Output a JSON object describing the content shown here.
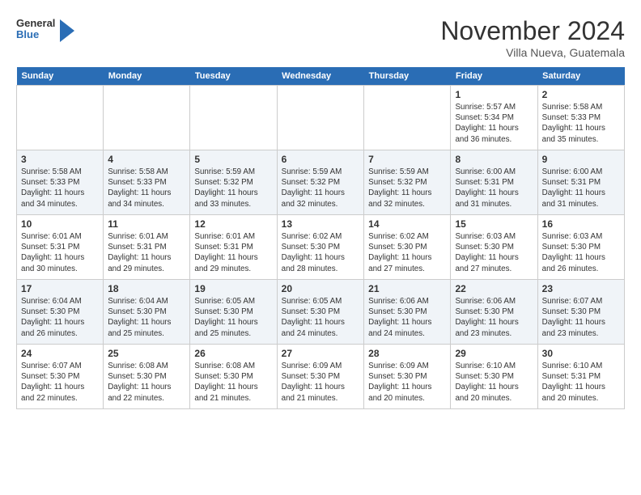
{
  "header": {
    "logo": {
      "line1": "General",
      "line2": "Blue"
    },
    "title": "November 2024",
    "location": "Villa Nueva, Guatemala"
  },
  "calendar": {
    "days_of_week": [
      "Sunday",
      "Monday",
      "Tuesday",
      "Wednesday",
      "Thursday",
      "Friday",
      "Saturday"
    ],
    "weeks": [
      [
        {
          "day": "",
          "info": ""
        },
        {
          "day": "",
          "info": ""
        },
        {
          "day": "",
          "info": ""
        },
        {
          "day": "",
          "info": ""
        },
        {
          "day": "",
          "info": ""
        },
        {
          "day": "1",
          "info": "Sunrise: 5:57 AM\nSunset: 5:34 PM\nDaylight: 11 hours and 36 minutes."
        },
        {
          "day": "2",
          "info": "Sunrise: 5:58 AM\nSunset: 5:33 PM\nDaylight: 11 hours and 35 minutes."
        }
      ],
      [
        {
          "day": "3",
          "info": "Sunrise: 5:58 AM\nSunset: 5:33 PM\nDaylight: 11 hours and 34 minutes."
        },
        {
          "day": "4",
          "info": "Sunrise: 5:58 AM\nSunset: 5:33 PM\nDaylight: 11 hours and 34 minutes."
        },
        {
          "day": "5",
          "info": "Sunrise: 5:59 AM\nSunset: 5:32 PM\nDaylight: 11 hours and 33 minutes."
        },
        {
          "day": "6",
          "info": "Sunrise: 5:59 AM\nSunset: 5:32 PM\nDaylight: 11 hours and 32 minutes."
        },
        {
          "day": "7",
          "info": "Sunrise: 5:59 AM\nSunset: 5:32 PM\nDaylight: 11 hours and 32 minutes."
        },
        {
          "day": "8",
          "info": "Sunrise: 6:00 AM\nSunset: 5:31 PM\nDaylight: 11 hours and 31 minutes."
        },
        {
          "day": "9",
          "info": "Sunrise: 6:00 AM\nSunset: 5:31 PM\nDaylight: 11 hours and 31 minutes."
        }
      ],
      [
        {
          "day": "10",
          "info": "Sunrise: 6:01 AM\nSunset: 5:31 PM\nDaylight: 11 hours and 30 minutes."
        },
        {
          "day": "11",
          "info": "Sunrise: 6:01 AM\nSunset: 5:31 PM\nDaylight: 11 hours and 29 minutes."
        },
        {
          "day": "12",
          "info": "Sunrise: 6:01 AM\nSunset: 5:31 PM\nDaylight: 11 hours and 29 minutes."
        },
        {
          "day": "13",
          "info": "Sunrise: 6:02 AM\nSunset: 5:30 PM\nDaylight: 11 hours and 28 minutes."
        },
        {
          "day": "14",
          "info": "Sunrise: 6:02 AM\nSunset: 5:30 PM\nDaylight: 11 hours and 27 minutes."
        },
        {
          "day": "15",
          "info": "Sunrise: 6:03 AM\nSunset: 5:30 PM\nDaylight: 11 hours and 27 minutes."
        },
        {
          "day": "16",
          "info": "Sunrise: 6:03 AM\nSunset: 5:30 PM\nDaylight: 11 hours and 26 minutes."
        }
      ],
      [
        {
          "day": "17",
          "info": "Sunrise: 6:04 AM\nSunset: 5:30 PM\nDaylight: 11 hours and 26 minutes."
        },
        {
          "day": "18",
          "info": "Sunrise: 6:04 AM\nSunset: 5:30 PM\nDaylight: 11 hours and 25 minutes."
        },
        {
          "day": "19",
          "info": "Sunrise: 6:05 AM\nSunset: 5:30 PM\nDaylight: 11 hours and 25 minutes."
        },
        {
          "day": "20",
          "info": "Sunrise: 6:05 AM\nSunset: 5:30 PM\nDaylight: 11 hours and 24 minutes."
        },
        {
          "day": "21",
          "info": "Sunrise: 6:06 AM\nSunset: 5:30 PM\nDaylight: 11 hours and 24 minutes."
        },
        {
          "day": "22",
          "info": "Sunrise: 6:06 AM\nSunset: 5:30 PM\nDaylight: 11 hours and 23 minutes."
        },
        {
          "day": "23",
          "info": "Sunrise: 6:07 AM\nSunset: 5:30 PM\nDaylight: 11 hours and 23 minutes."
        }
      ],
      [
        {
          "day": "24",
          "info": "Sunrise: 6:07 AM\nSunset: 5:30 PM\nDaylight: 11 hours and 22 minutes."
        },
        {
          "day": "25",
          "info": "Sunrise: 6:08 AM\nSunset: 5:30 PM\nDaylight: 11 hours and 22 minutes."
        },
        {
          "day": "26",
          "info": "Sunrise: 6:08 AM\nSunset: 5:30 PM\nDaylight: 11 hours and 21 minutes."
        },
        {
          "day": "27",
          "info": "Sunrise: 6:09 AM\nSunset: 5:30 PM\nDaylight: 11 hours and 21 minutes."
        },
        {
          "day": "28",
          "info": "Sunrise: 6:09 AM\nSunset: 5:30 PM\nDaylight: 11 hours and 20 minutes."
        },
        {
          "day": "29",
          "info": "Sunrise: 6:10 AM\nSunset: 5:30 PM\nDaylight: 11 hours and 20 minutes."
        },
        {
          "day": "30",
          "info": "Sunrise: 6:10 AM\nSunset: 5:31 PM\nDaylight: 11 hours and 20 minutes."
        }
      ]
    ]
  }
}
